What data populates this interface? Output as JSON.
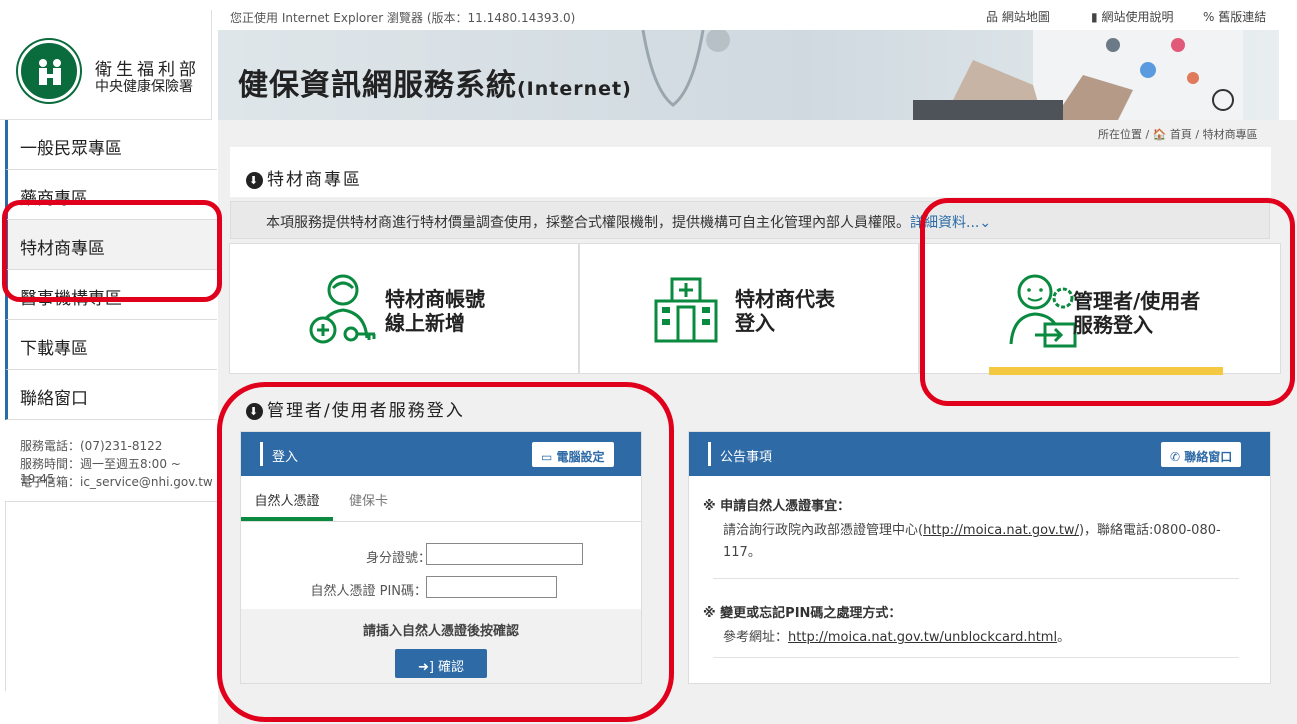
{
  "topbar": {
    "browser_note": "您正使用 Internet Explorer 瀏覽器 (版本：11.1480.14393.0)",
    "links": [
      "網站地圖",
      "網站使用說明",
      "舊版連結"
    ]
  },
  "logo": {
    "org_line1": "衛生福利部",
    "org_line2": "中央健康保險署"
  },
  "banner": {
    "title_zh": "健保資訊網服務系統",
    "title_en": "(Internet)"
  },
  "breadcrumb": "所在位置 / 🏠 首頁 / 特材商專區",
  "sidebar": {
    "items": [
      {
        "label": "一般民眾專區"
      },
      {
        "label": "藥商專區"
      },
      {
        "label": "特材商專區"
      },
      {
        "label": "醫事機構專區"
      },
      {
        "label": "下載專區"
      },
      {
        "label": "聯絡窗口"
      }
    ],
    "info": [
      "服務電話：(07)231-8122",
      "服務時間：週一至週五8:00 ~ 19:45",
      "電子信箱：ic_service@nhi.gov.tw"
    ]
  },
  "section1": {
    "title": "特材商專區",
    "description": "本項服務提供特材商進行特材價量調查使用，採整合式權限機制，提供機構可自主化管理內部人員權限。",
    "more": "詳細資料...⌄"
  },
  "tiles": [
    {
      "line1": "特材商帳號",
      "line2": "線上新增"
    },
    {
      "line1": "特材商代表",
      "line2": "登入"
    },
    {
      "line1": "管理者/使用者",
      "line2": "服務登入"
    }
  ],
  "section2": {
    "title": "管理者/使用者服務登入"
  },
  "login": {
    "header": "登入",
    "pc_setting_btn": "電腦設定",
    "tabs": [
      "自然人憑證",
      "健保卡"
    ],
    "id_label": "身分證號：",
    "pin_label": "自然人憑證 PIN碼：",
    "id_value": "",
    "pin_value": "",
    "hint": "請插入自然人憑證後按確認",
    "confirm_btn": "確認"
  },
  "notice": {
    "header": "公告事項",
    "contact_btn": "聯絡窗口",
    "items": [
      {
        "title": "※ 申請自然人憑證事宜：",
        "text_before": "請洽詢行政院內政部憑證管理中心(",
        "link": "http://moica.nat.gov.tw/",
        "text_after": ")，聯絡電話:0800-080-",
        "text_line2": "117。"
      },
      {
        "title": "※ 變更或忘記PIN碼之處理方式：",
        "text_before": "參考網址：",
        "link": "http://moica.nat.gov.tw/unblockcard.html",
        "text_after": "。"
      }
    ]
  },
  "colors": {
    "brand_blue": "#2d6aa6",
    "brand_green": "#0a8a3f",
    "highlight_red": "#e0001b",
    "active_tab_yellow": "#f5c842"
  }
}
